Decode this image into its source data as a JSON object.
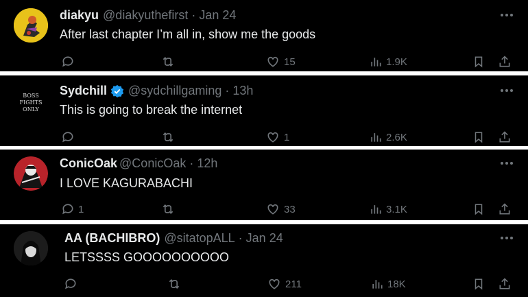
{
  "tweets": [
    {
      "name": "diakyu",
      "handle": "@diakyuthefirst",
      "time": "Jan 24",
      "verified": false,
      "text": "After last chapter I’m all in, show me the goods",
      "replies": "",
      "retweets": "",
      "likes": "15",
      "views": "1.9K"
    },
    {
      "name": "Sydchill",
      "handle": "@sydchillgaming",
      "time": "13h",
      "verified": true,
      "text": "This is going to break the internet",
      "replies": "",
      "retweets": "",
      "likes": "1",
      "views": "2.6K",
      "avatar_text": "BOSS FIGHTS ONLY"
    },
    {
      "name": "ConicOak",
      "handle": "@ConicOak",
      "time": "12h",
      "verified": false,
      "text": "I LOVE KAGURABACHI",
      "replies": "1",
      "retweets": "",
      "likes": "33",
      "views": "3.1K"
    },
    {
      "name": "AA (BACHIBRO)",
      "handle": "@sitatopALL",
      "time": "Jan 24",
      "verified": false,
      "text": "LETSSSS GOOOOOOOOOO",
      "replies": "",
      "retweets": "",
      "likes": "211",
      "views": "18K"
    }
  ],
  "separator": "·",
  "colors": {
    "background": "#000000",
    "text": "#e7e9ea",
    "muted": "#71767b",
    "verified": "#1d9bf0",
    "divider": "#ffffff"
  }
}
